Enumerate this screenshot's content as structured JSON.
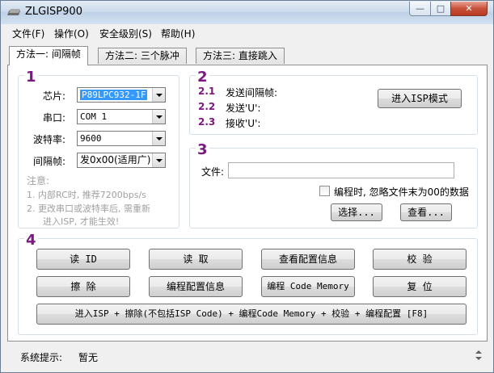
{
  "window": {
    "title": "ZLGISP900",
    "min_glyph": "—",
    "max_glyph": "□",
    "close_glyph": "✕"
  },
  "menu": [
    "文件(F)",
    "操作(O)",
    "安全级别(S)",
    "帮助(H)"
  ],
  "tabs": [
    "方法一: 间隔帧",
    "方法二: 三个脉冲",
    "方法三: 直接跳入"
  ],
  "group1": {
    "number": "1",
    "chip_label": "芯片:",
    "chip_value": "P89LPC932-1F",
    "port_label": "串口:",
    "port_value": "COM 1",
    "baud_label": "波特率:",
    "baud_value": "9600",
    "frame_label": "间隔帧:",
    "frame_value": "发0x00(适用广)",
    "note_title": "注意:",
    "note1": "1. 内部RC时, 推荐7200bps/s",
    "note2": "2. 更改串口或波特率后, 需重新",
    "note3": "进入ISP, 才能生效!"
  },
  "group2": {
    "number": "2",
    "steps": [
      {
        "num": "2.1",
        "text": "发送间隔帧:"
      },
      {
        "num": "2.2",
        "text": "发送'U':"
      },
      {
        "num": "2.3",
        "text": "接收'U':"
      }
    ],
    "enter_isp_button": "进入ISP模式"
  },
  "group3": {
    "number": "3",
    "file_label": "文件:",
    "file_value": "",
    "ignore_label": "编程时, 忽略文件末为00的数据",
    "ignore_checked": false,
    "select_button": "选择...",
    "view_button": "查看..."
  },
  "group4": {
    "number": "4",
    "row1": [
      "读 ID",
      "读 取",
      "查看配置信息",
      "校 验"
    ],
    "row2": [
      "擦 除",
      "编程配置信息",
      "编程 Code Memory",
      "复 位"
    ],
    "combo_button": "进入ISP + 擦除(不包括ISP Code) + 编程Code Memory + 校验 + 编程配置 [F8]"
  },
  "status": {
    "label": "系统提示:",
    "value": "暂无"
  },
  "colors": {
    "accent": "#7a1a80",
    "selection": "#3399ff"
  }
}
